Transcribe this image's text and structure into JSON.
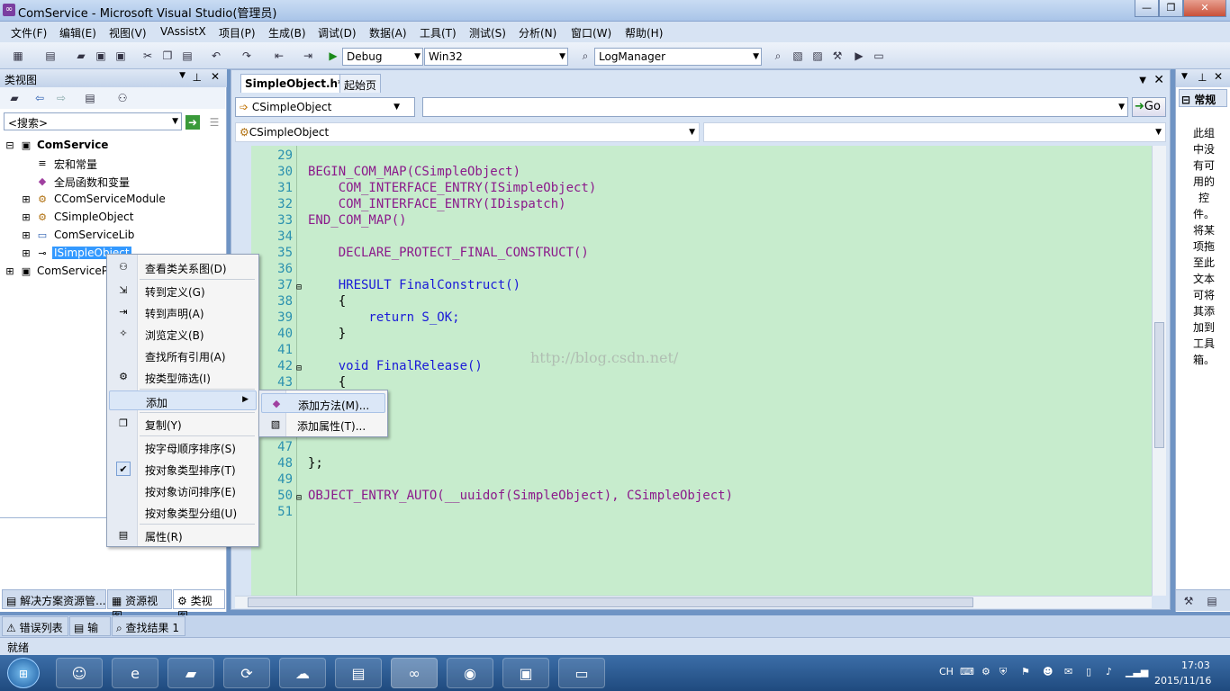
{
  "window": {
    "title": "ComService - Microsoft Visual Studio(管理员)",
    "controls": [
      "—",
      "❐",
      "✕"
    ]
  },
  "menu": [
    "文件(F)",
    "编辑(E)",
    "视图(V)",
    "VAssistX",
    "项目(P)",
    "生成(B)",
    "调试(D)",
    "数据(A)",
    "工具(T)",
    "测试(S)",
    "分析(N)",
    "窗口(W)",
    "帮助(H)"
  ],
  "toolbar": {
    "config": "Debug",
    "platform": "Win32",
    "find": "LogManager"
  },
  "classview": {
    "title": "类视图",
    "search_placeholder": "<搜索>",
    "tree": [
      {
        "label": "ComService",
        "icon": "project-icon"
      },
      {
        "label": "宏和常量",
        "icon": "macro-icon"
      },
      {
        "label": "全局函数和变量",
        "icon": "global-icon"
      },
      {
        "label": "CComServiceModule",
        "icon": "class-icon"
      },
      {
        "label": "CSimpleObject",
        "icon": "class-icon"
      },
      {
        "label": "ComServiceLib",
        "icon": "lib-icon"
      },
      {
        "label": "ISimpleObject",
        "icon": "interface-icon"
      },
      {
        "label": "ComServiceP",
        "icon": "project-icon"
      }
    ],
    "bottom_tabs": [
      "解决方案资源管...",
      "资源视图",
      "类视图"
    ]
  },
  "editor": {
    "tabs": [
      "SimpleObject.h*",
      "起始页"
    ],
    "class_combo": "CSimpleObject",
    "member_combo": "",
    "go_label": "Go",
    "scope_combo": "CSimpleObject",
    "watermark": "http://blog.csdn.net/",
    "lines": [
      {
        "n": "29",
        "t": ""
      },
      {
        "n": "30",
        "t": "BEGIN_COM_MAP(CSimpleObject)"
      },
      {
        "n": "31",
        "t": "    COM_INTERFACE_ENTRY(ISimpleObject)"
      },
      {
        "n": "32",
        "t": "    COM_INTERFACE_ENTRY(IDispatch)"
      },
      {
        "n": "33",
        "t": "END_COM_MAP()"
      },
      {
        "n": "34",
        "t": ""
      },
      {
        "n": "35",
        "t": "    DECLARE_PROTECT_FINAL_CONSTRUCT()"
      },
      {
        "n": "36",
        "t": ""
      },
      {
        "n": "37",
        "t": "    HRESULT FinalConstruct()"
      },
      {
        "n": "38",
        "t": "    {"
      },
      {
        "n": "39",
        "t": "        return S_OK;"
      },
      {
        "n": "40",
        "t": "    }"
      },
      {
        "n": "41",
        "t": ""
      },
      {
        "n": "42",
        "t": "    void FinalRelease()"
      },
      {
        "n": "43",
        "t": "    {"
      },
      {
        "n": "44",
        "t": ""
      },
      {
        "n": "45",
        "t": ""
      },
      {
        "n": "46",
        "t": ""
      },
      {
        "n": "47",
        "t": ""
      },
      {
        "n": "48",
        "t": "};"
      },
      {
        "n": "49",
        "t": ""
      },
      {
        "n": "50",
        "t": "OBJECT_ENTRY_AUTO(__uuidof(SimpleObject), CSimpleObject)"
      },
      {
        "n": "51",
        "t": ""
      }
    ]
  },
  "context_menu": [
    "查看类关系图(D)",
    "转到定义(G)",
    "转到声明(A)",
    "浏览定义(B)",
    "查找所有引用(A)",
    "按类型筛选(I)",
    "添加",
    "复制(Y)",
    "按字母顺序排序(S)",
    "按对象类型排序(T)",
    "按对象访问排序(E)",
    "按对象类型分组(U)",
    "属性(R)"
  ],
  "submenu": [
    "添加方法(M)...",
    "添加属性(T)..."
  ],
  "toolbox": {
    "title": "常规",
    "message": "此组中没有可用的控件。将某项拖至此文本可将其添加到工具箱。"
  },
  "output_tabs": [
    "错误列表",
    "输出",
    "查找结果 1"
  ],
  "status": "就绪",
  "tray": {
    "lang": "CH",
    "time": "17:03",
    "date": "2015/11/16"
  }
}
